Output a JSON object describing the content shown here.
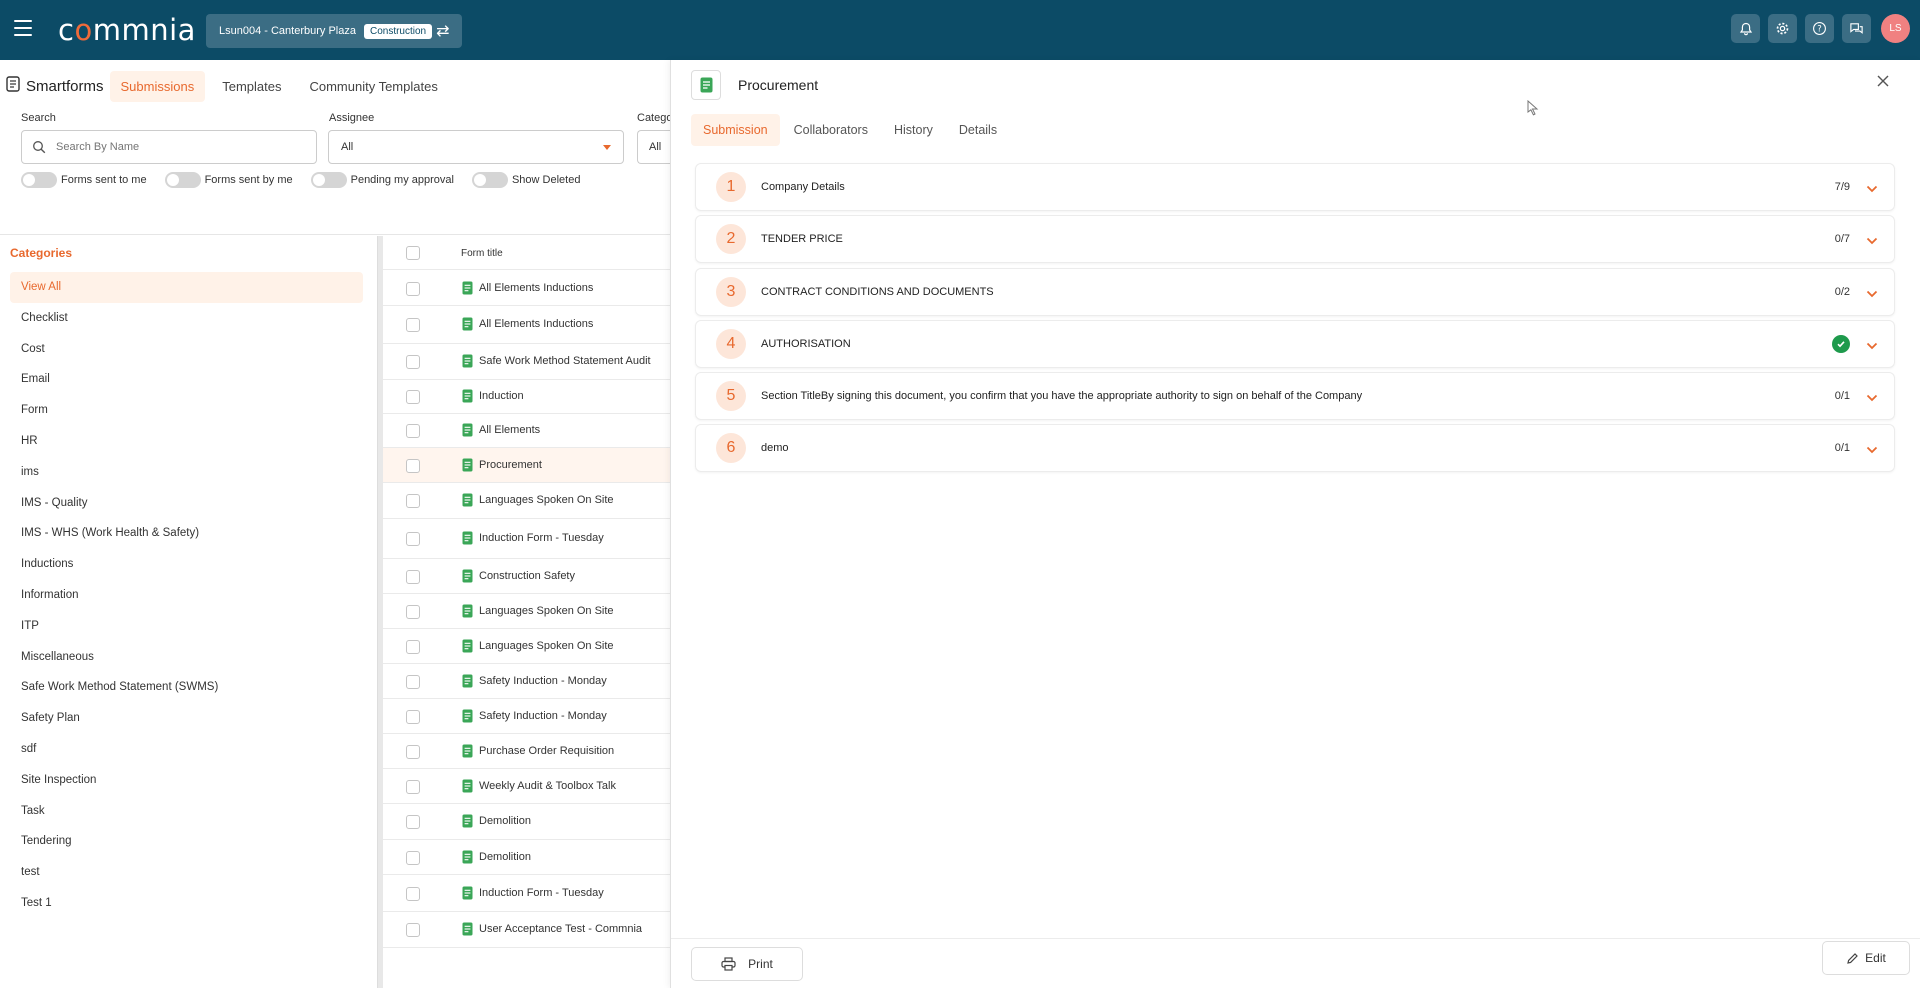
{
  "header": {
    "logo_text": "commnia",
    "project_name": "Lsun004 - Canterbury Plaza",
    "project_badge": "Construction",
    "avatar_initials": "LS",
    "colors": {
      "bar": "#0c4b66",
      "accent": "#e8692e",
      "avatar": "#f08181"
    }
  },
  "subnav": {
    "title": "Smartforms",
    "tabs": [
      "Submissions",
      "Templates",
      "Community Templates"
    ],
    "active_tab": "Submissions"
  },
  "filters": {
    "search_label": "Search",
    "search_placeholder": "Search By Name",
    "assignee_label": "Assignee",
    "assignee_value": "All",
    "category_label": "Catego",
    "category_value": "All",
    "toggles": [
      "Forms sent to me",
      "Forms sent by me",
      "Pending my approval",
      "Show Deleted"
    ]
  },
  "categories": {
    "heading": "Categories",
    "items": [
      "View All",
      "Checklist",
      "Cost",
      "Email",
      "Form",
      "HR",
      "ims",
      "IMS - Quality",
      "IMS - WHS (Work Health & Safety)",
      "Inductions",
      "Information",
      "ITP",
      "Miscellaneous",
      "Safe Work Method Statement (SWMS)",
      "Safety Plan",
      "sdf",
      "Site Inspection",
      "Task",
      "Tendering",
      "test",
      "Test 1"
    ],
    "active": "View All"
  },
  "table": {
    "column_title": "Form title",
    "rows": [
      "All Elements Inductions",
      "All Elements Inductions",
      "Safe Work Method Statement Audit",
      "Induction",
      "All Elements",
      "Procurement",
      "Languages Spoken On Site",
      "Induction Form - Tuesday",
      "Construction Safety",
      "Languages Spoken On Site",
      "Languages Spoken On Site",
      "Safety Induction - Monday",
      "Safety Induction - Monday",
      "Purchase Order Requisition",
      "Weekly Audit & Toolbox Talk",
      "Demolition",
      "Demolition",
      "Induction Form - Tuesday",
      "User Acceptance Test - Commnia"
    ],
    "active_row": "Procurement"
  },
  "panel": {
    "title": "Procurement",
    "tabs": [
      "Submission",
      "Collaborators",
      "History",
      "Details"
    ],
    "active_tab": "Submission",
    "sections": [
      {
        "num": "1",
        "title": "Company Details",
        "count": "7/9"
      },
      {
        "num": "2",
        "title": "TENDER PRICE",
        "count": "0/7"
      },
      {
        "num": "3",
        "title": "CONTRACT CONDITIONS AND DOCUMENTS",
        "count": "0/2"
      },
      {
        "num": "4",
        "title": "AUTHORISATION",
        "count": ""
      },
      {
        "num": "5",
        "title": "Section TitleBy signing this document, you confirm that you have the appropriate authority to sign on behalf of the Company",
        "count": "0/1"
      },
      {
        "num": "6",
        "title": "demo",
        "count": "0/1"
      }
    ],
    "print_label": "Print",
    "edit_label": "Edit"
  }
}
